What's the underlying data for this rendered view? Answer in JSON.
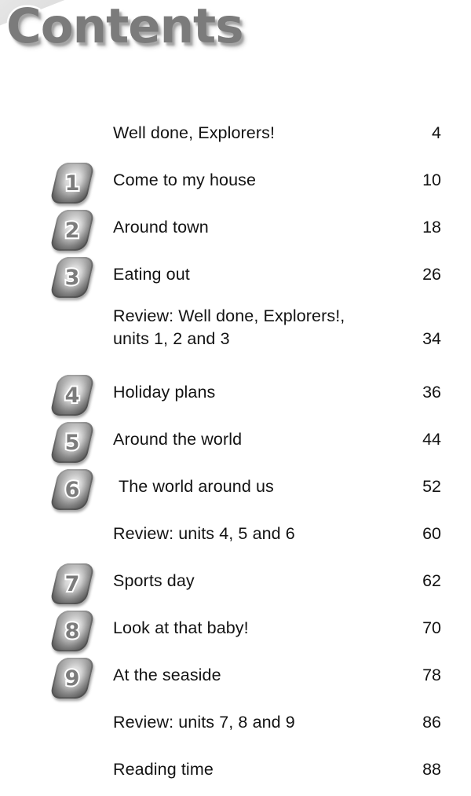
{
  "title": "Contents",
  "contents": {
    "rows": [
      {
        "unit": "",
        "title": "Well done, Explorers!",
        "page": "4"
      },
      {
        "unit": "1",
        "title": "Come to my house",
        "page": "10"
      },
      {
        "unit": "2",
        "title": "Around town",
        "page": "18"
      },
      {
        "unit": "3",
        "title": "Eating out",
        "page": "26"
      },
      {
        "unit": "",
        "title": "Review: Well done, Explorers!, units 1, 2 and 3",
        "line1": "Review: Well done, Explorers!,",
        "line2": "units 1, 2 and 3",
        "page": "34"
      },
      {
        "unit": "4",
        "title": "Holiday plans",
        "page": "36"
      },
      {
        "unit": "5",
        "title": "Around the world",
        "page": "44"
      },
      {
        "unit": "6",
        "title": "The world around us",
        "page": "52"
      },
      {
        "unit": "",
        "title": "Review: units 4, 5 and 6",
        "page": "60"
      },
      {
        "unit": "7",
        "title": "Sports day",
        "page": "62"
      },
      {
        "unit": "8",
        "title": "Look at that baby!",
        "page": "70"
      },
      {
        "unit": "9",
        "title": "At the seaside",
        "page": "78"
      },
      {
        "unit": "",
        "title": "Review: units 7, 8 and 9",
        "page": "86"
      },
      {
        "unit": "",
        "title": "Reading time",
        "page": "88"
      }
    ]
  },
  "colors": {
    "text": "#131313",
    "title_fill": "#7b7b7b",
    "title_outline": "#ffffff",
    "badge_dark": "#6d6d6d",
    "badge_light": "#f4f4f4",
    "banner_bg": "#e8e8e8",
    "banner_border": "#2a2a2a",
    "page_bg": "#ffffff"
  }
}
